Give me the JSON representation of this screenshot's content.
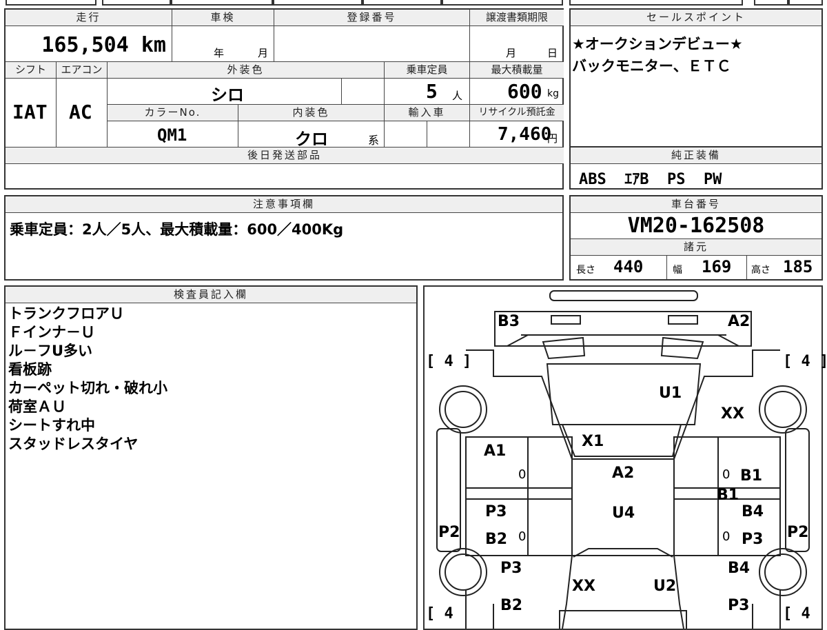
{
  "left_top": {
    "headers": {
      "mileage": "走行",
      "inspection": "車検",
      "registration": "登録番号",
      "transfer_deadline": "譲渡書類期限",
      "shift": "シフト",
      "aircon": "エアコン",
      "exterior_color": "外装色",
      "capacity": "乗車定員",
      "max_load": "最大積載量",
      "color_no": "カラーNo.",
      "interior_color": "内装色",
      "import": "輸入車",
      "recycle": "リサイクル預託金",
      "later_parts": "後日発送部品"
    },
    "mileage_value": "165,504 km",
    "inspection_year": "年",
    "inspection_month": "月",
    "deadline_month": "月",
    "deadline_day": "日",
    "shift_value": "IAT",
    "aircon_value": "AC",
    "exterior_value": "シロ",
    "capacity_value": "5",
    "capacity_unit": "人",
    "max_load_value": "600",
    "max_load_unit": "kg",
    "color_no_value": "QM1",
    "interior_value": "クロ",
    "interior_suffix": "系",
    "recycle_value": "7,460",
    "recycle_unit": "円"
  },
  "sales_point": {
    "header": "セールスポイント",
    "lines": [
      "★オークションデビュー★",
      "バックモニター、ＥＴＣ"
    ]
  },
  "genuine_equipment": {
    "header": "純正装備",
    "value": "ABS  ｴｱB  PS  PW"
  },
  "notes": {
    "header": "注意事項欄",
    "value": "乗車定員：2人／5人、最大積載量：600／400Kg"
  },
  "chassis": {
    "header": "車台番号",
    "value": "VM20-162508",
    "spec_header": "諸元",
    "length_label": "長さ",
    "length_value": "440",
    "width_label": "幅",
    "width_value": "169",
    "height_label": "高さ",
    "height_value": "185"
  },
  "inspector": {
    "header": "検査員記入欄",
    "lines": [
      "トランクフロアＵ",
      "Ｆインナ－Ｕ",
      "ル－フU多い",
      "看板跡",
      "カーペット切れ・破れ小",
      "荷室ＡＵ",
      "シートすれ中",
      "スタッドレスタイヤ"
    ]
  },
  "diagram": {
    "tire_left_top": "[ 4 ]",
    "tire_right_top": "[ 4 ]",
    "tire_left_bottom": "[ 4",
    "tire_right_bottom": "[ 4",
    "marks": {
      "b3": "B3",
      "a2_top": "A2",
      "u1": "U1",
      "xx_right": "XX",
      "x1": "X1",
      "a1": "A1",
      "a2_mid": "A2",
      "b1_right": "B1",
      "b1_mid": "B1",
      "p3_left": "P3",
      "u4": "U4",
      "b4_right": "B4",
      "p2_left": "P2",
      "b2_left": "B2",
      "p3_right": "P3",
      "p2_right": "P2",
      "p3_left2": "P3",
      "b4_right2": "B4",
      "xx_bottom": "XX",
      "u2": "U2",
      "b2_bottom": "B2",
      "p3_bottom": "P3",
      "zero1": "0",
      "zero2": "0",
      "zero3": "0",
      "zero4": "0"
    }
  }
}
